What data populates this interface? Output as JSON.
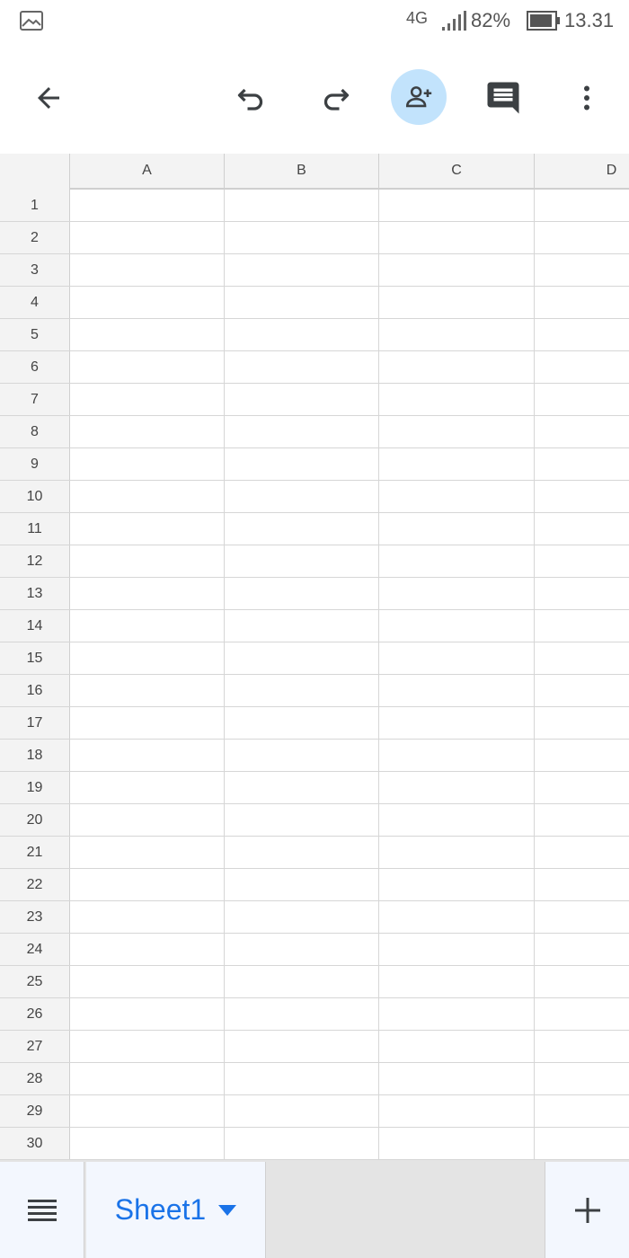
{
  "status_bar": {
    "network": "4G",
    "battery_percent": "82%",
    "time": "13.31",
    "icons": [
      "gallery-icon",
      "signal-icon",
      "battery-icon"
    ]
  },
  "toolbar": {
    "buttons": [
      "back-arrow-icon",
      "undo-icon",
      "redo-icon",
      "add-person-icon",
      "comment-icon",
      "more-vert-icon"
    ],
    "accent_color": "#c2e3fc"
  },
  "sheet": {
    "columns": [
      "A",
      "B",
      "C",
      "D"
    ],
    "rows": [
      "1",
      "2",
      "3",
      "4",
      "5",
      "6",
      "7",
      "8",
      "9",
      "10",
      "11",
      "12",
      "13",
      "14",
      "15",
      "16",
      "17",
      "18",
      "19",
      "20",
      "21",
      "22",
      "23",
      "24",
      "25",
      "26",
      "27",
      "28",
      "29",
      "30"
    ]
  },
  "bottom_bar": {
    "active_tab": "Sheet1",
    "tab_color": "#1a73e8"
  }
}
